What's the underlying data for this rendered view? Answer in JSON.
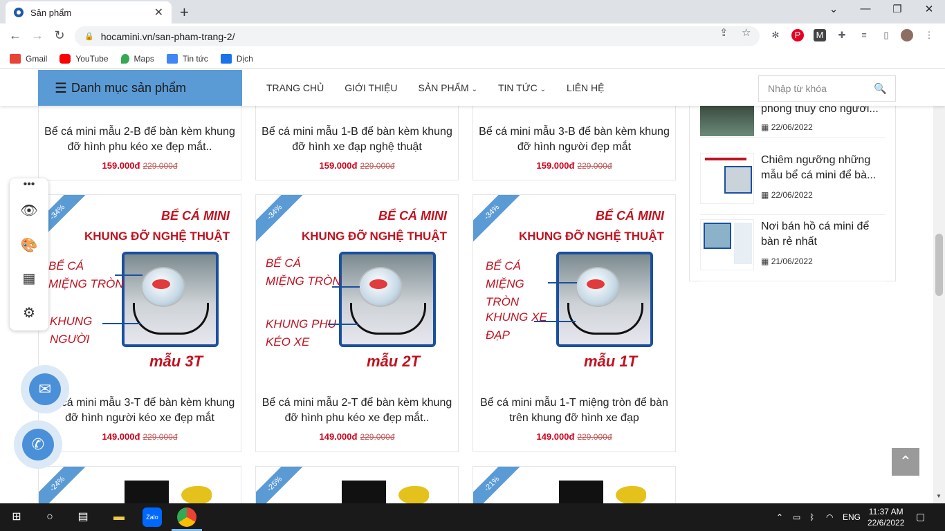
{
  "browser": {
    "tab_title": "Sản phẩm",
    "url": "hocamini.vn/san-pham-trang-2/",
    "bookmarks": [
      "Gmail",
      "YouTube",
      "Maps",
      "Tin tức",
      "Dịch"
    ]
  },
  "site": {
    "category_button": "Danh mục sản phẩm",
    "menu": [
      "TRANG CHỦ",
      "GIỚI THIỆU",
      "SẢN PHẨM",
      "TIN TỨC",
      "LIÊN HỆ"
    ],
    "search_placeholder": "Nhập từ khóa"
  },
  "products_row1": [
    {
      "title": "Bể cá mini mẫu 2-B để bàn kèm khung đỡ hình phu kéo xe đẹp mắt..",
      "price": "159.000đ",
      "old_price": "229.000đ"
    },
    {
      "title": "Bể cá mini mẫu 1-B để bàn kèm khung đỡ hình xe đạp nghệ thuật",
      "price": "159.000đ",
      "old_price": "229.000đ"
    },
    {
      "title": "Bể cá mini mẫu 3-B để bàn kèm khung đỡ hình người đẹp mắt",
      "price": "159.000đ",
      "old_price": "229.000đ"
    }
  ],
  "products_row2": [
    {
      "badge": "-34%",
      "art_title1": "BỂ CÁ MINI",
      "art_title2": "KHUNG ĐỠ NGHỆ THUẬT",
      "label_top": "BỂ CÁ MIỆNG TRÒN",
      "label_bottom": "KHUNG NGƯỜI",
      "model": "mẫu 3T",
      "title": "Bể cá mini mẫu 3-T để bàn kèm khung đỡ hình người kéo xe đẹp mắt",
      "price": "149.000đ",
      "old_price": "229.000đ"
    },
    {
      "badge": "-34%",
      "art_title1": "BỂ CÁ MINI",
      "art_title2": "KHUNG ĐỠ NGHỆ THUẬT",
      "label_top": "BỂ CÁ MIỆNG TRÒN",
      "label_bottom": "KHUNG PHU KÉO XE",
      "model": "mẫu 2T",
      "title": "Bể cá mini mẫu 2-T để bàn kèm khung đỡ hình phu kéo xe đẹp mắt..",
      "price": "149.000đ",
      "old_price": "229.000đ"
    },
    {
      "badge": "-34%",
      "art_title1": "BỂ CÁ MINI",
      "art_title2": "KHUNG ĐỠ NGHỆ THUẬT",
      "label_top": "BỂ CÁ MIỆNG TRÒN",
      "label_bottom": "KHUNG XE ĐẠP",
      "model": "mẫu 1T",
      "title": "Bể cá mini mẫu 1-T miệng tròn để bàn trên khung đỡ hình xe đạp",
      "price": "149.000đ",
      "old_price": "229.000đ"
    }
  ],
  "products_row3": [
    {
      "badge": "-24%"
    },
    {
      "badge": "-25%"
    },
    {
      "badge": "-21%"
    }
  ],
  "sidebar_posts": [
    {
      "title": "phong thủy cho người...",
      "date": "22/06/2022"
    },
    {
      "title": "Chiêm ngưỡng những mẫu bể cá mini để bà...",
      "date": "22/06/2022"
    },
    {
      "title": "Nơi bán hồ cá mini để bàn rẻ nhất",
      "date": "21/06/2022"
    }
  ],
  "taskbar": {
    "lang": "ENG",
    "time": "11:37 AM",
    "date": "22/6/2022"
  },
  "colors": {
    "accent": "#5b9bd5",
    "price": "#d0021b"
  }
}
